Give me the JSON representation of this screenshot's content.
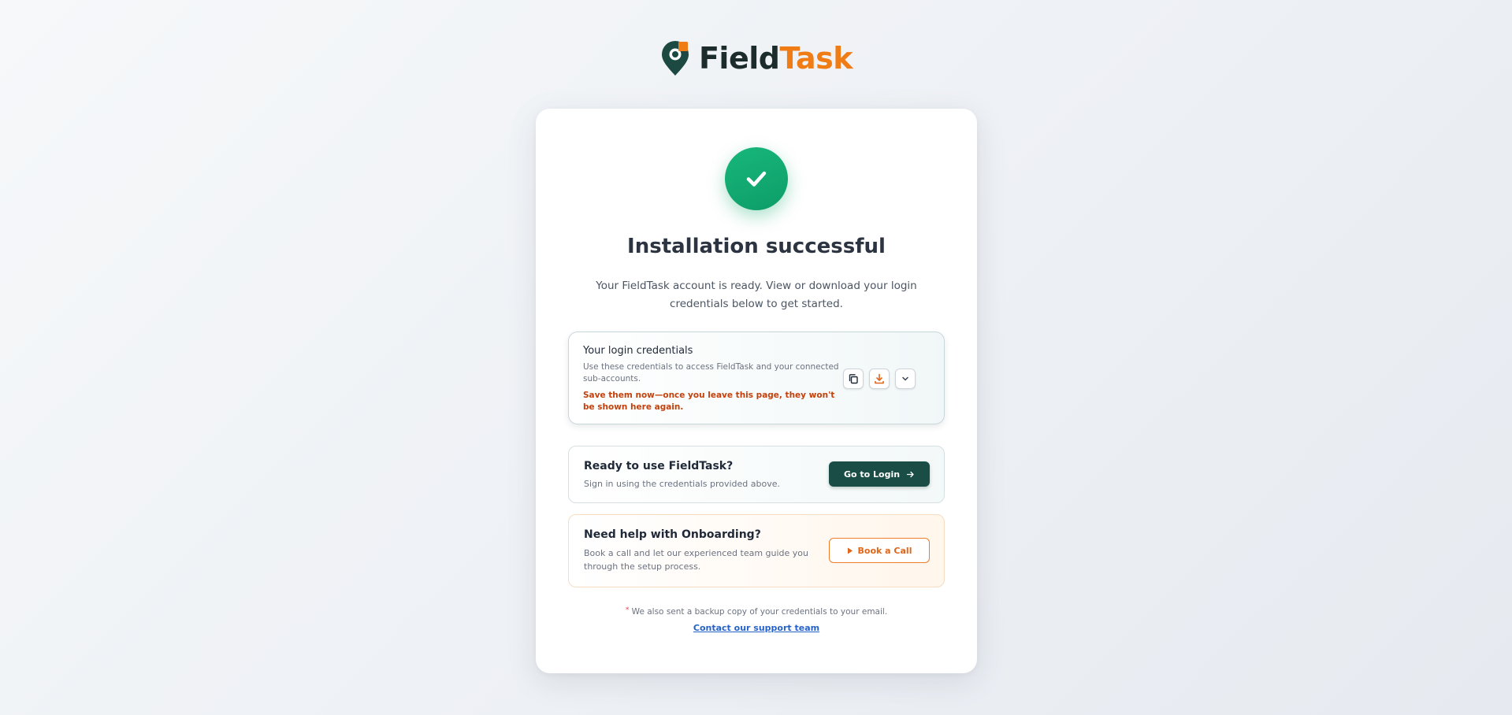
{
  "brand": {
    "name_part1": "Field",
    "name_part2": "Task",
    "colors": {
      "dark": "#1c2b2b",
      "accent": "#f07c16",
      "teal": "#1a4d45"
    }
  },
  "status": {
    "icon": "checkmark-icon",
    "color": "#12a872",
    "title": "Installation successful",
    "subtitle": "Your FieldTask account is ready. View or download your login credentials below to get started."
  },
  "credentials": {
    "title": "Your login credentials",
    "description": "Use these credentials to access FieldTask and your connected sub-accounts.",
    "warning": "Save them now—once you leave this page, they won't be shown here again.",
    "actions": [
      {
        "name": "copy",
        "icon": "copy-icon"
      },
      {
        "name": "download",
        "icon": "download-icon"
      },
      {
        "name": "expand",
        "icon": "chevron-down-icon"
      }
    ]
  },
  "ready": {
    "title": "Ready to use FieldTask?",
    "description": "Sign in using the credentials provided above.",
    "button_label": "Go to Login",
    "button_icon": "arrow-right-icon"
  },
  "onboarding": {
    "title": "Need help with Onboarding?",
    "description": "Book a call and let our experienced team guide you through the setup process.",
    "button_label": "Book a Call",
    "button_icon": "play-icon"
  },
  "footer": {
    "star": "*",
    "note": "We also sent a backup copy of your credentials to your email.",
    "support_link": "Contact our support team"
  }
}
